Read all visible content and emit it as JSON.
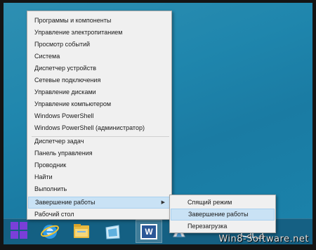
{
  "context_menu": {
    "group1": [
      "Программы и компоненты",
      "Управление электропитанием",
      "Просмотр событий",
      "Система",
      "Диспетчер устройств",
      "Сетевые подключения",
      "Управление дисками",
      "Управление компьютером",
      "Windows PowerShell",
      "Windows PowerShell (администратор)"
    ],
    "group2": [
      "Диспетчер задач",
      "Панель управления",
      "Проводник",
      "Найти",
      "Выполнить"
    ],
    "group3": [
      "Завершение работы",
      "Рабочий стол"
    ],
    "submenu_arrow": "▶"
  },
  "submenu": {
    "items": [
      "Спящий режим",
      "Завершение работы",
      "Перезагрузка"
    ]
  },
  "taskbar": {
    "icons": [
      "windows-start-icon",
      "internet-explorer-icon",
      "file-explorer-icon",
      "store-icon",
      "word-icon",
      "app-icon"
    ],
    "word_letter": "W"
  },
  "watermark": "Win8-Software.net",
  "colors": {
    "desktop": "#1f86ad",
    "menu_bg": "#f0f0f0",
    "highlight": "#c9e2f5",
    "start_tile": "#7a3fd9"
  }
}
